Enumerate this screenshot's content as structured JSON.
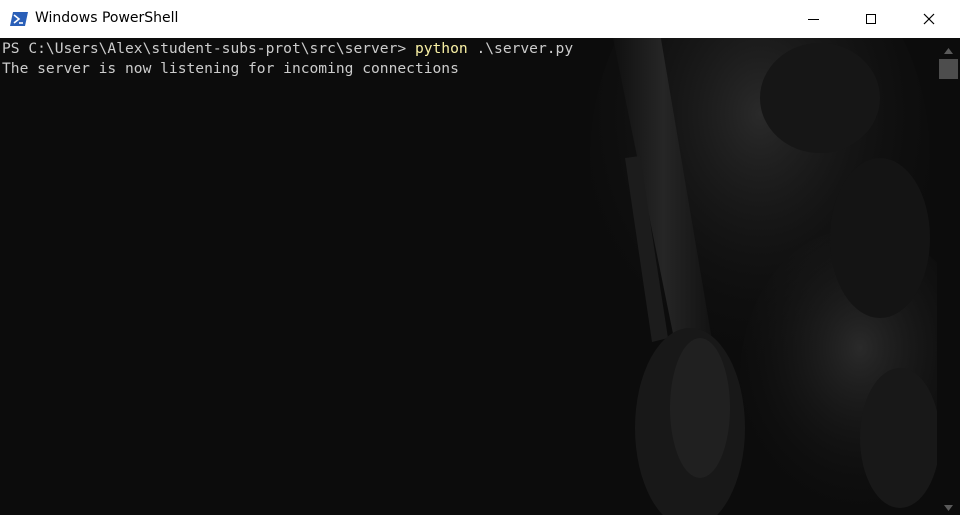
{
  "window": {
    "title": "Windows PowerShell",
    "icon": "powershell-icon"
  },
  "controls": {
    "minimize_icon": "minimize-icon",
    "maximize_icon": "maximize-icon",
    "close_icon": "close-icon"
  },
  "console": {
    "prompt": "PS C:\\Users\\Alex\\student-subs-prot\\src\\server> ",
    "command": "python",
    "args": " .\\server.py",
    "output": "The server is now listening for incoming connections"
  },
  "colors": {
    "background": "#0c0c0c",
    "text": "#cccccc",
    "command": "#f9f1a5",
    "titlebar": "#ffffff",
    "icon_blue": "#2a5fb8"
  }
}
